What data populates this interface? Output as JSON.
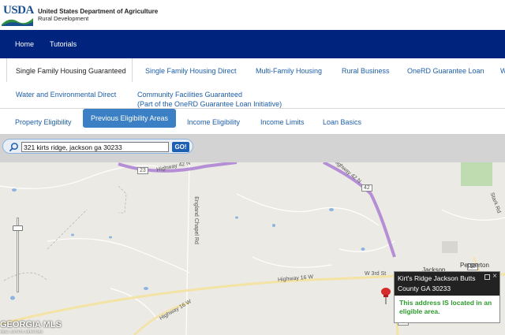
{
  "header": {
    "logo": "USDA",
    "department": "United States Department of Agriculture",
    "agency": "Rural Development"
  },
  "nav": {
    "home": "Home",
    "tutorials": "Tutorials"
  },
  "programs": {
    "items": [
      "Single Family Housing Guaranteed",
      "Single Family Housing Direct",
      "Multi-Family Housing",
      "Rural Business",
      "OneRD Guarantee Loan",
      "W"
    ],
    "row2": {
      "water": "Water and Environmental Direct",
      "community_line1": "Community Facilities Guaranteed",
      "community_line2": "(Part of the OneRD Guarantee Loan Initiative)"
    },
    "active_index": 0
  },
  "subtabs": {
    "items": [
      "Property Eligibility",
      "Previous Eligibility Areas",
      "Income Eligibility",
      "Income Limits",
      "Loan Basics"
    ],
    "active_index": 1
  },
  "search": {
    "value": "321 kirts ridge, jackson ga 30233",
    "go_label": "GO!"
  },
  "map": {
    "labels": {
      "hwy42_left": "Highway 42 N",
      "hwy42_right": "Highway 42 N",
      "route23": "23",
      "route42": "42",
      "route36": "36",
      "route16": "16",
      "england_chapel": "England Chapel Rd",
      "hwy16_w": "Highway 16 W",
      "hwy16_w2": "Highway 16 W",
      "w3rd": "W 3rd St",
      "pepperton": "Pepperton",
      "jackson": "Jackson",
      "stark": "Stark Rd"
    },
    "watermark": "GEORGIA MLS",
    "watermark_sub": "REAL ESTATE SERVICES"
  },
  "popup": {
    "title": "Kirt's Ridge Jackson Butts County GA 30233",
    "message": "This address IS located in an eligible area.",
    "close": "×"
  },
  "colors": {
    "nav_bg": "#00247d",
    "link": "#1d5ea8",
    "active_subtab": "#3b7fc4",
    "eligible_green": "#2e9a2e",
    "highway": "#b58fd6"
  }
}
